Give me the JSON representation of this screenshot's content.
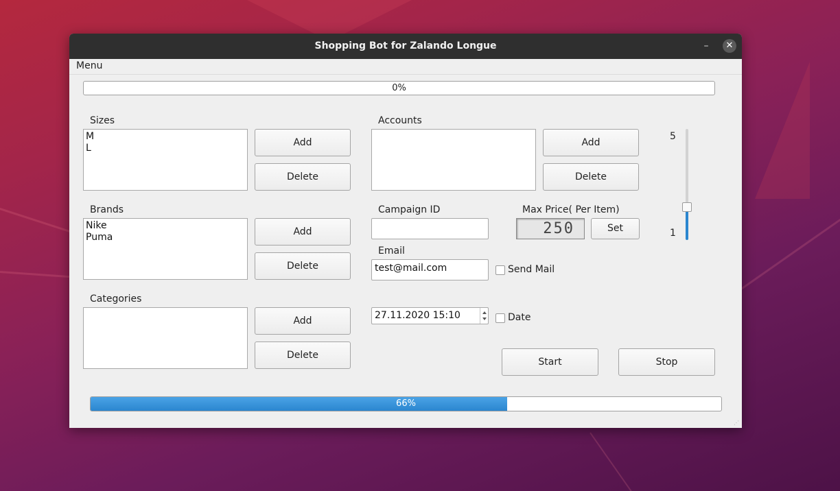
{
  "window": {
    "title": "Shopping Bot for Zalando Longue",
    "minimize_symbol": "–",
    "close_symbol": "✕"
  },
  "menubar": {
    "menu_label": "Menu"
  },
  "progress_top": {
    "text": "0%",
    "value": 0.0
  },
  "sizes": {
    "label": "Sizes",
    "items": [
      "M",
      "L"
    ],
    "add_label": "Add",
    "delete_label": "Delete"
  },
  "brands": {
    "label": "Brands",
    "items": [
      "Nike",
      "Puma"
    ],
    "add_label": "Add",
    "delete_label": "Delete"
  },
  "categories": {
    "label": "Categories",
    "items": [],
    "add_label": "Add",
    "delete_label": "Delete"
  },
  "accounts": {
    "label": "Accounts",
    "items": [],
    "add_label": "Add",
    "delete_label": "Delete"
  },
  "campaign": {
    "label": "Campaign ID",
    "value": ""
  },
  "max_price": {
    "label": "Max Price( Per Item)",
    "display_value": "250",
    "set_label": "Set"
  },
  "email": {
    "label": "Email",
    "value": "test@mail.com",
    "send_mail_label": "Send Mail",
    "send_mail_checked": false
  },
  "date": {
    "value": "27.11.2020 15:10",
    "checkbox_label": "Date",
    "checked": false
  },
  "slider": {
    "max_label": "5",
    "min_label": "1",
    "min": 1,
    "max": 5,
    "value": 2.1
  },
  "actions": {
    "start_label": "Start",
    "stop_label": "Stop"
  },
  "progress_bottom": {
    "text": "66%",
    "value": 0.66
  },
  "colors": {
    "accent": "#2b86cf",
    "titlebar": "#2f2f2f",
    "window_bg": "#efefef"
  }
}
